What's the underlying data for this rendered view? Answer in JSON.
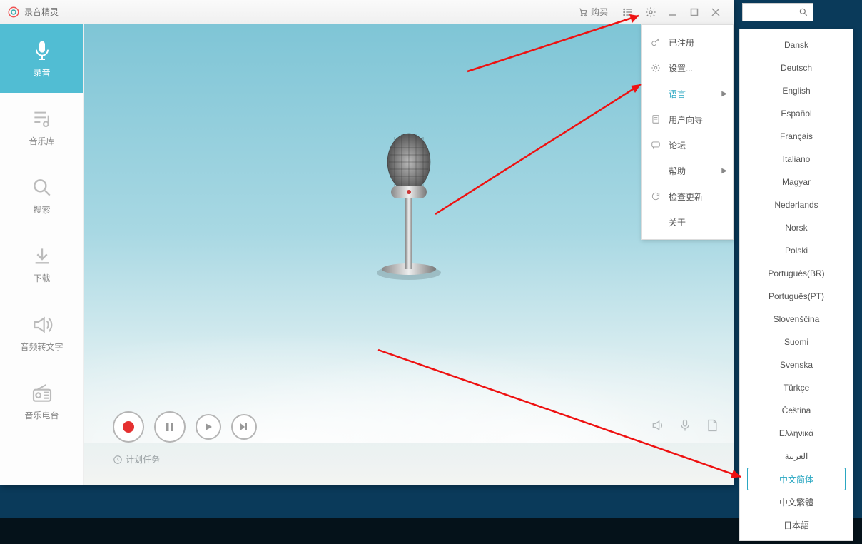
{
  "app": {
    "title": "录音精灵",
    "buy_label": "购买"
  },
  "sidebar": {
    "items": [
      {
        "label": "录音",
        "icon": "mic"
      },
      {
        "label": "音乐库",
        "icon": "music"
      },
      {
        "label": "搜索",
        "icon": "search"
      },
      {
        "label": "下载",
        "icon": "download"
      },
      {
        "label": "音频转文字",
        "icon": "speaker"
      },
      {
        "label": "音乐电台",
        "icon": "radio"
      }
    ]
  },
  "schedule": {
    "label": "计划任务"
  },
  "settings_menu": {
    "items": [
      {
        "label": "已注册",
        "icon": "key",
        "chevron": false
      },
      {
        "label": "设置...",
        "icon": "gear",
        "chevron": false
      },
      {
        "label": "语言",
        "icon": "",
        "chevron": true,
        "highlight": true
      },
      {
        "label": "用户向导",
        "icon": "doc",
        "chevron": false
      },
      {
        "label": "论坛",
        "icon": "chat",
        "chevron": false
      },
      {
        "label": "帮助",
        "icon": "",
        "chevron": true
      },
      {
        "label": "检查更新",
        "icon": "refresh",
        "chevron": false
      },
      {
        "label": "关于",
        "icon": "",
        "chevron": false
      }
    ]
  },
  "languages": [
    "Dansk",
    "Deutsch",
    "English",
    "Español",
    "Français",
    "Italiano",
    "Magyar",
    "Nederlands",
    "Norsk",
    "Polski",
    "Português(BR)",
    "Português(PT)",
    "Slovenščina",
    "Suomi",
    "Svenska",
    "Türkçe",
    "Čeština",
    "Ελληνικά",
    "العربية",
    "中文简体",
    "中文繁體",
    "日本語"
  ],
  "languages_selected": "中文简体"
}
